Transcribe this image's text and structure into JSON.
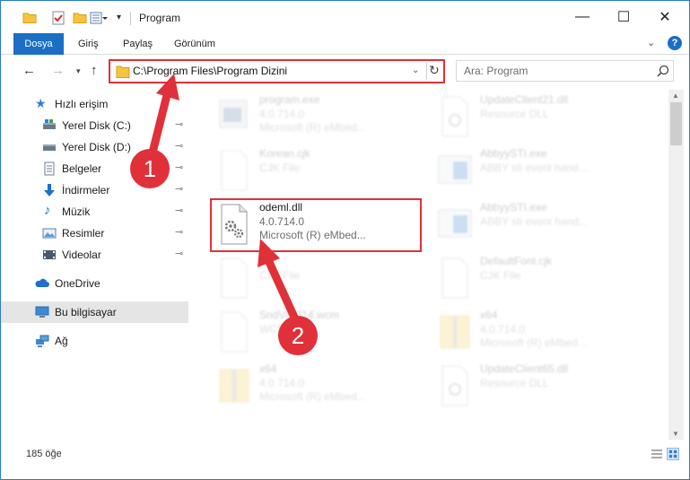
{
  "window": {
    "title": "Program",
    "min_glyph": "—",
    "max_glyph": "☐",
    "close_glyph": "✕"
  },
  "ribbon": {
    "tabs": [
      {
        "label": "Dosya"
      },
      {
        "label": "Giriş"
      },
      {
        "label": "Paylaş"
      },
      {
        "label": "Görünüm"
      }
    ],
    "help_glyph": "?"
  },
  "nav": {
    "back_glyph": "←",
    "forward_glyph": "→",
    "up_glyph": "↑",
    "address": "C:\\Program Files\\Program Dizini",
    "search_placeholder": "Ara: Program"
  },
  "sidebar": {
    "items": [
      {
        "label": "Hızlı erişim",
        "icon": "star-icon",
        "pinned": false
      },
      {
        "label": "Yerel Disk (C:)",
        "icon": "drive-icon",
        "pinned": true
      },
      {
        "label": "Yerel Disk (D:)",
        "icon": "drive-icon",
        "pinned": true
      },
      {
        "label": "Belgeler",
        "icon": "documents-icon",
        "pinned": true
      },
      {
        "label": "İndirmeler",
        "icon": "downloads-icon",
        "pinned": true
      },
      {
        "label": "Müzik",
        "icon": "music-icon",
        "pinned": true
      },
      {
        "label": "Resimler",
        "icon": "pictures-icon",
        "pinned": true
      },
      {
        "label": "Videolar",
        "icon": "videos-icon",
        "pinned": true
      },
      {
        "label": "OneDrive",
        "icon": "onedrive-icon",
        "pinned": false
      },
      {
        "label": "Bu bilgisayar",
        "icon": "computer-icon",
        "pinned": false,
        "selected": true
      },
      {
        "label": "Ağ",
        "icon": "network-icon",
        "pinned": false
      }
    ],
    "pin_glyph": "📌"
  },
  "files": [
    {
      "name": "program.exe",
      "l1": "4.0.714.0",
      "l2": "Microsoft (R) eMbed...",
      "icon": "exe-icon",
      "faded": true
    },
    {
      "name": "UpdateClient21.dll",
      "l1": "Resource DLL",
      "l2": "",
      "icon": "dll-icon",
      "faded": true
    },
    {
      "name": "Korean.cjk",
      "l1": "CJK File",
      "l2": "",
      "icon": "blank-file-icon",
      "faded": true
    },
    {
      "name": "AbbyySTI.exe",
      "l1": "ABBY sti event hand...",
      "l2": "",
      "icon": "app-window-icon",
      "faded": true
    },
    {
      "name": "odeml.dll",
      "l1": "4.0.714.0",
      "l2": "Microsoft (R) eMbed...",
      "icon": "dll-gear-icon",
      "faded": false
    },
    {
      "name": "AbbyySTI.exe",
      "l1": "ABBY sti event hand...",
      "l2": "",
      "icon": "app-window-icon",
      "faded": true
    },
    {
      "name": "",
      "l1": "CJK File",
      "l2": "",
      "icon": "blank-file-icon",
      "faded": true
    },
    {
      "name": "DefaultFont.cjk",
      "l1": "CJK File",
      "l2": "",
      "icon": "blank-file-icon",
      "faded": true
    },
    {
      "name": "SndVMP14.wcm",
      "l1": "WCM File",
      "l2": "",
      "icon": "blank-file-icon",
      "faded": true
    },
    {
      "name": "x64",
      "l1": "4.0.714.0",
      "l2": "Microsoft (R) eMbed...",
      "icon": "zip-folder-icon",
      "faded": true
    },
    {
      "name": "x64",
      "l1": "4.0.714.0",
      "l2": "Microsoft (R) eMbed...",
      "icon": "zip-folder-icon",
      "faded": true
    },
    {
      "name": "UpdateClient65.dll",
      "l1": "Resource DLL",
      "l2": "",
      "icon": "dll-icon",
      "faded": true
    }
  ],
  "status": {
    "count": "185 öğe"
  },
  "annotations": {
    "one": "1",
    "two": "2"
  },
  "colors": {
    "accent": "#1a6fc4",
    "highlight_red": "#e0303a",
    "selected_bg": "#e5e5e5"
  }
}
